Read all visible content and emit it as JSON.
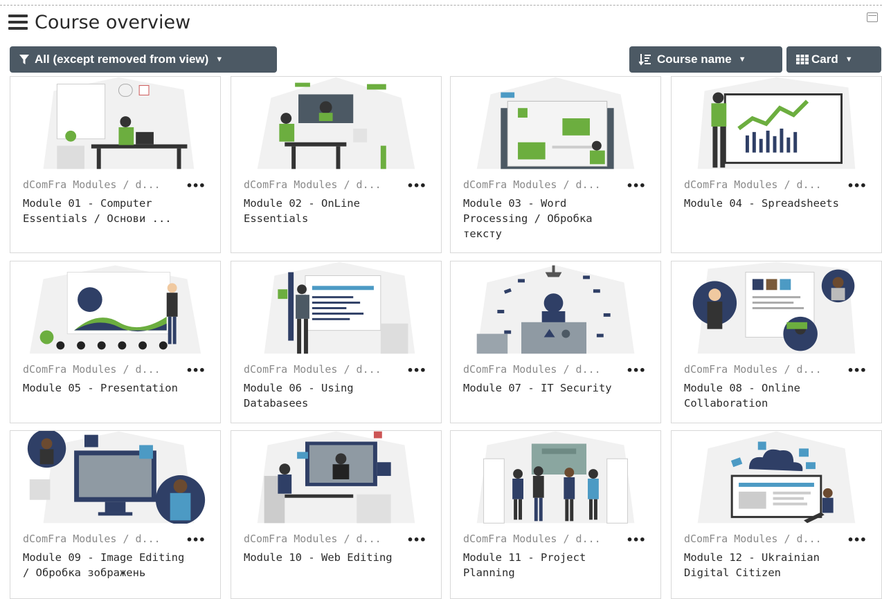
{
  "header": {
    "title": "Course overview"
  },
  "toolbar": {
    "filter_label": "All (except removed from view)",
    "sort_label": "Course name",
    "view_label": "Card"
  },
  "courses": [
    {
      "category": "dComFra Modules / d...",
      "name": "Module 01 - Computer Essentials / Основи ...",
      "menu": "•••"
    },
    {
      "category": "dComFra Modules / d...",
      "name": "Module 02 - OnLine Essentials",
      "menu": "•••"
    },
    {
      "category": "dComFra Modules / d...",
      "name": "Module 03 - Word Processing / Обробка тексту",
      "menu": "•••"
    },
    {
      "category": "dComFra Modules / d...",
      "name": "Module 04 - Spreadsheets",
      "menu": "•••"
    },
    {
      "category": "dComFra Modules / d...",
      "name": "Module 05 - Presentation",
      "menu": "•••"
    },
    {
      "category": "dComFra Modules / d...",
      "name": "Module 06 - Using Databasees",
      "menu": "•••"
    },
    {
      "category": "dComFra Modules / d...",
      "name": "Module 07 - IT Security",
      "menu": "•••"
    },
    {
      "category": "dComFra Modules / d...",
      "name": "Module 08 - Online Collaboration",
      "menu": "•••"
    },
    {
      "category": "dComFra Modules / d...",
      "name": "Module 09 - Image Editing / Обробка зображень",
      "menu": "•••"
    },
    {
      "category": "dComFra Modules / d...",
      "name": "Module 10 - Web Editing",
      "menu": "•••"
    },
    {
      "category": "dComFra Modules / d...",
      "name": "Module 11 - Project Planning",
      "menu": "•••"
    },
    {
      "category": "dComFra Modules / d...",
      "name": "Module 12 - Ukrainian Digital Citizen",
      "menu": "•••"
    }
  ],
  "colors": {
    "button_bg": "#4c5964",
    "accent_green": "#6cae3f",
    "text_muted": "#8a8a8a"
  },
  "icons": {
    "menu": "hamburger-icon",
    "filter": "funnel-icon",
    "sort": "sort-icon",
    "view": "grid-icon",
    "collapse": "collapse-icon"
  }
}
